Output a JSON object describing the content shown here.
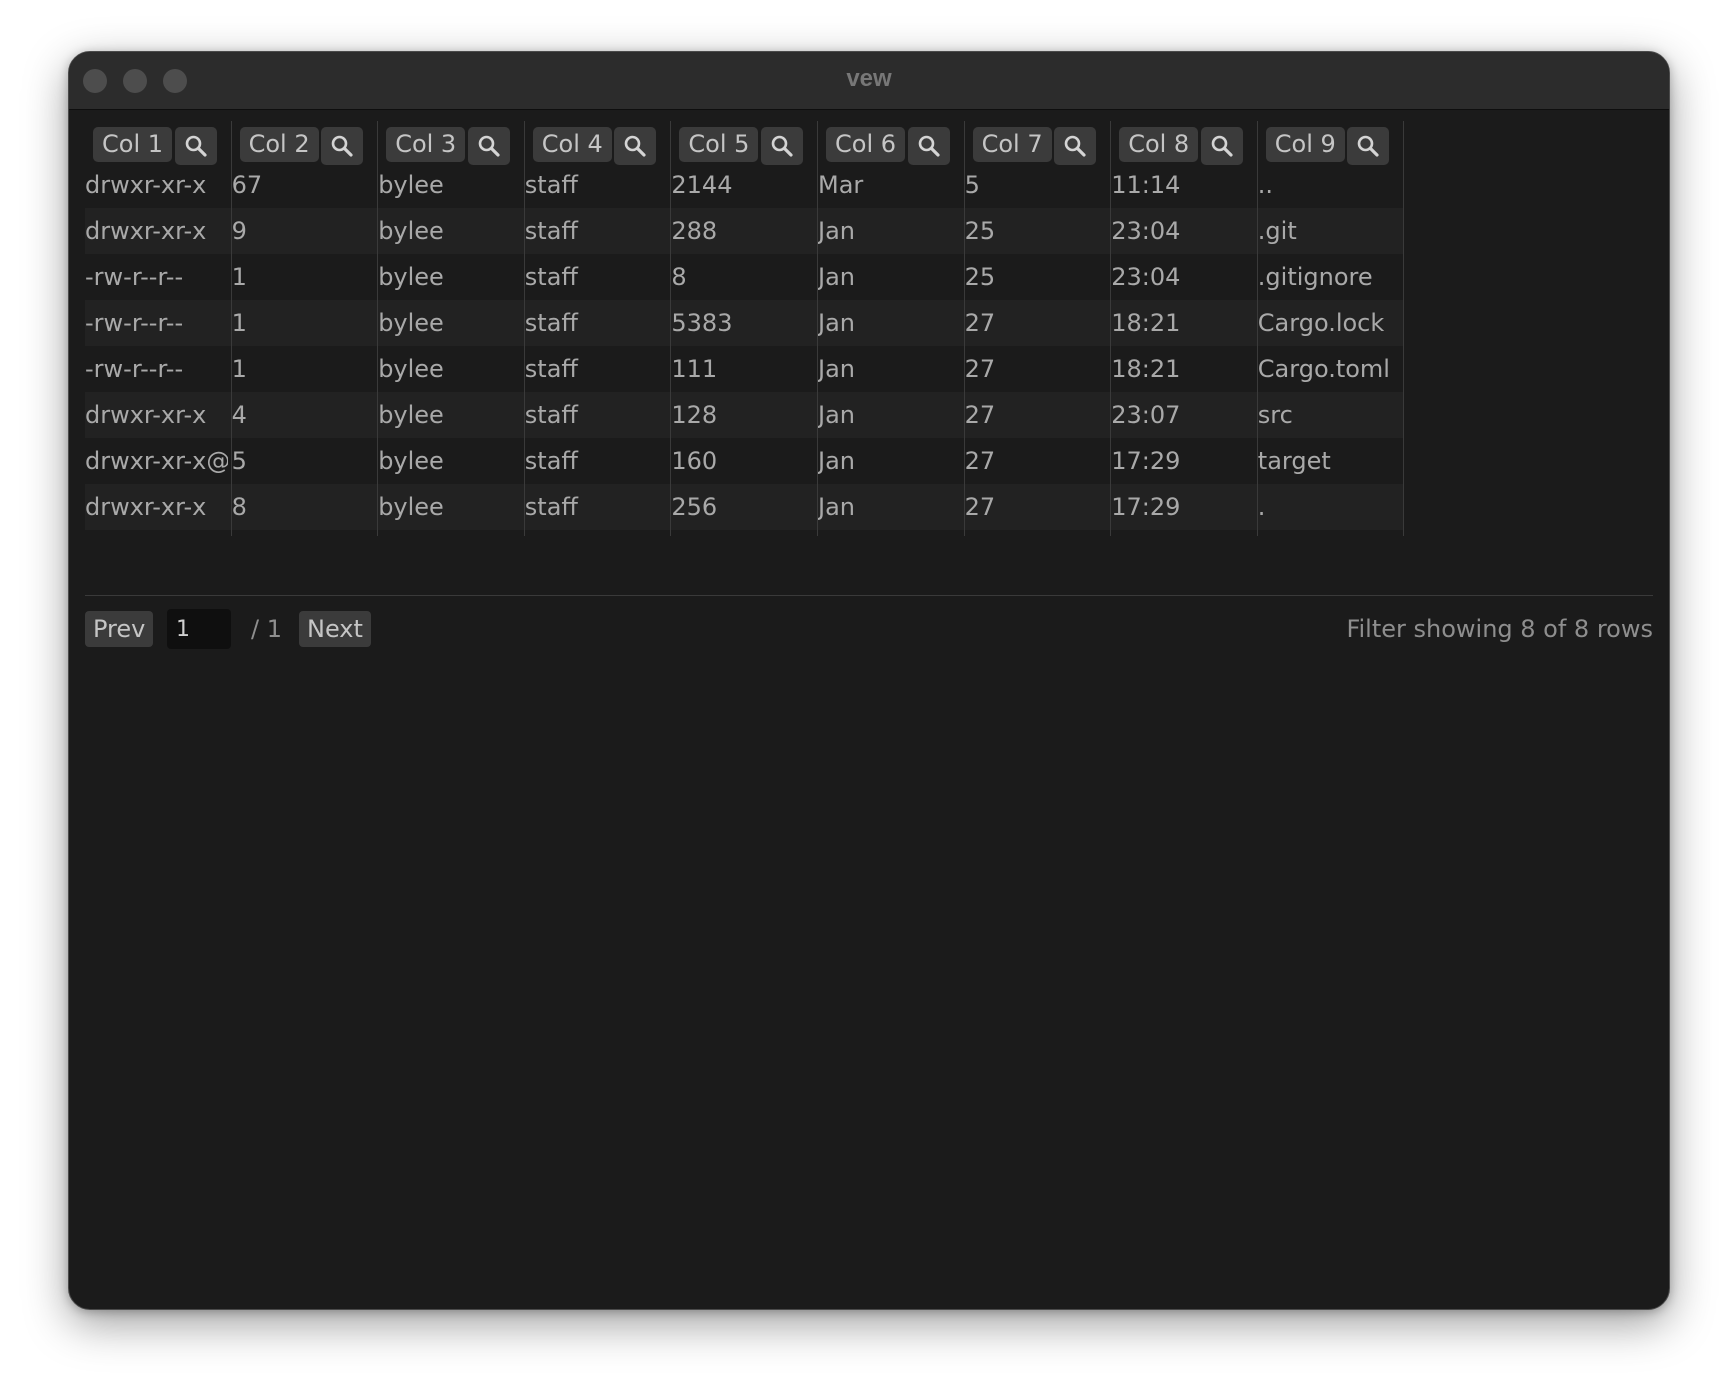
{
  "window": {
    "title": "vew"
  },
  "table": {
    "columns": [
      {
        "label": "Col 1"
      },
      {
        "label": "Col 2"
      },
      {
        "label": "Col 3"
      },
      {
        "label": "Col 4"
      },
      {
        "label": "Col 5"
      },
      {
        "label": "Col 6"
      },
      {
        "label": "Col 7"
      },
      {
        "label": "Col 8"
      },
      {
        "label": "Col 9"
      }
    ],
    "rows": [
      [
        "drwxr-xr-x",
        "67",
        "bylee",
        "staff",
        "2144",
        "Mar",
        "5",
        "11:14",
        ".."
      ],
      [
        "drwxr-xr-x",
        "9",
        "bylee",
        "staff",
        "288",
        "Jan",
        "25",
        "23:04",
        ".git"
      ],
      [
        "-rw-r--r--",
        "1",
        "bylee",
        "staff",
        "8",
        "Jan",
        "25",
        "23:04",
        ".gitignore"
      ],
      [
        "-rw-r--r--",
        "1",
        "bylee",
        "staff",
        "5383",
        "Jan",
        "27",
        "18:21",
        "Cargo.lock"
      ],
      [
        "-rw-r--r--",
        "1",
        "bylee",
        "staff",
        "111",
        "Jan",
        "27",
        "18:21",
        "Cargo.toml"
      ],
      [
        "drwxr-xr-x",
        "4",
        "bylee",
        "staff",
        "128",
        "Jan",
        "27",
        "23:07",
        "src"
      ],
      [
        "drwxr-xr-x@",
        "5",
        "bylee",
        "staff",
        "160",
        "Jan",
        "27",
        "17:29",
        "target"
      ],
      [
        "drwxr-xr-x",
        "8",
        "bylee",
        "staff",
        "256",
        "Jan",
        "27",
        "17:29",
        "."
      ]
    ]
  },
  "pagination": {
    "prev_label": "Prev",
    "page_value": "1",
    "total_label": "/ 1",
    "next_label": "Next"
  },
  "status": {
    "filter_text": "Filter showing 8 of 8 rows"
  },
  "colors": {
    "window_bg": "#1b1b1b",
    "titlebar_bg": "#2c2c2c",
    "button_bg": "#3b3b3b",
    "alt_row_bg": "#222222",
    "text": "#a9a9a9"
  },
  "icons": {
    "column_filter": "search-icon"
  }
}
